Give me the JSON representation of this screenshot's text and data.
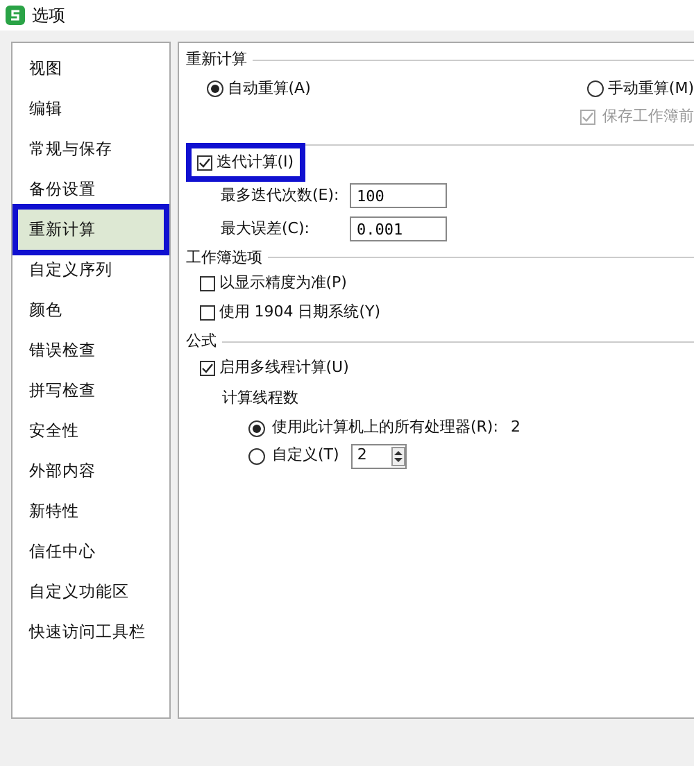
{
  "window": {
    "title": "选项"
  },
  "sidebar": {
    "items": [
      {
        "label": "视图",
        "selected": false,
        "highlighted": false
      },
      {
        "label": "编辑",
        "selected": false,
        "highlighted": false
      },
      {
        "label": "常规与保存",
        "selected": false,
        "highlighted": false
      },
      {
        "label": "备份设置",
        "selected": false,
        "highlighted": false
      },
      {
        "label": "重新计算",
        "selected": true,
        "highlighted": true
      },
      {
        "label": "自定义序列",
        "selected": false,
        "highlighted": false
      },
      {
        "label": "颜色",
        "selected": false,
        "highlighted": false
      },
      {
        "label": "错误检查",
        "selected": false,
        "highlighted": false
      },
      {
        "label": "拼写检查",
        "selected": false,
        "highlighted": false
      },
      {
        "label": "安全性",
        "selected": false,
        "highlighted": false
      },
      {
        "label": "外部内容",
        "selected": false,
        "highlighted": false
      },
      {
        "label": "新特性",
        "selected": false,
        "highlighted": false
      },
      {
        "label": "信任中心",
        "selected": false,
        "highlighted": false
      },
      {
        "label": "自定义功能区",
        "selected": false,
        "highlighted": false
      },
      {
        "label": "快速访问工具栏",
        "selected": false,
        "highlighted": false
      }
    ]
  },
  "sections": [
    {
      "title": "重新计算",
      "rows": [
        {
          "kind": "radios",
          "options": [
            {
              "label": "自动重算(A)",
              "selected": true
            },
            {
              "label": "手动重算(M)",
              "selected": false
            }
          ]
        },
        {
          "kind": "sub-checkbox",
          "label": "保存工作簿前",
          "checked": true,
          "disabled": true
        }
      ]
    },
    {
      "rows": [
        {
          "kind": "checkbox",
          "label": "迭代计算(I)",
          "checked": true,
          "highlighted": true
        },
        {
          "kind": "field",
          "label": "最多迭代次数(E):",
          "value": "100"
        },
        {
          "kind": "field",
          "label": "最大误差(C):",
          "value": "0.001"
        }
      ]
    },
    {
      "title": "工作簿选项",
      "rows": [
        {
          "kind": "checkbox",
          "label": "以显示精度为准(P)",
          "checked": false,
          "highlighted": false
        },
        {
          "kind": "checkbox",
          "label": "使用 1904 日期系统(Y)",
          "checked": false,
          "highlighted": false
        }
      ]
    },
    {
      "title": "公式",
      "rows": [
        {
          "kind": "checkbox",
          "label": "启用多线程计算(U)",
          "checked": true,
          "highlighted": false
        },
        {
          "kind": "caption",
          "label": "计算线程数"
        },
        {
          "kind": "radio",
          "label": "使用此计算机上的所有处理器(R):",
          "reading": "2",
          "selected": true
        },
        {
          "kind": "spin-radio",
          "label": "自定义(T)",
          "value": "2",
          "selected": false
        }
      ]
    }
  ]
}
